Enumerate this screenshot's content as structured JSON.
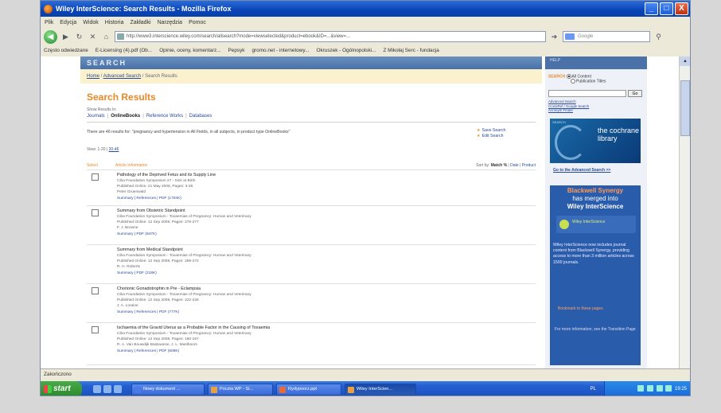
{
  "window": {
    "title": "Wiley InterScience: Search Results - Mozilla Firefox",
    "buttons": [
      "_",
      "□",
      "X"
    ]
  },
  "menu": [
    "Plik",
    "Edycja",
    "Widok",
    "Historia",
    "Zakładki",
    "Narzędzia",
    "Pomoc"
  ],
  "nav": {
    "url": "http://www3.interscience.wiley.com/search/allsearch?mode=viewselected&product=ebook&ID=...&view=...",
    "search_placeholder": "Google"
  },
  "bookmarks": [
    "Często odwiedzane",
    "E-Licensing (4).pdf (Ob...",
    "Opinie, oceny, komentarz...",
    "Pepsyk",
    "gromo.net - internetowy...",
    "Okruszek - Ogólnopolski...",
    "Z Mikołaj Serc - fundacja"
  ],
  "page": {
    "search_band": "SEARCH",
    "right_band": "HELP",
    "breadcrumb": [
      "Home",
      "Advanced Search",
      "Search Results"
    ],
    "heading": "Search Results",
    "show_in": "Show Results In:",
    "tabs": [
      "Journals",
      "OnlineBooks",
      "Reference Works",
      "Databases"
    ],
    "active_tab": "OnlineBooks",
    "result_info": "There are 46 results for: \"pregnancy and hypertension in All Fields, in all subjects, in product type OnlineBooks\"",
    "save_search": "Save Search",
    "edit_search": "Edit Search",
    "view_label": "View: 1-20",
    "next_label": "20-46",
    "col_select": "Select",
    "col_article": "Article Information",
    "sort_label": "Sort by:",
    "sort_match": "Match %",
    "sort_date": "Date",
    "sort_product": "Product"
  },
  "results": [
    {
      "title": "Pathology of the Deprived Fetus and its Supply Line",
      "l1": "Ciba Foundation Symposium 27 - Size at Birth",
      "l2": "Published Online: 21 May 2008, Pages: 3-28",
      "l3": "Peter Gruenwald",
      "links": "Summary | References | PDF (1704K)"
    },
    {
      "title": "Summary from Obstetric Standpoint",
      "l1": "Ciba Foundation Symposium - Toxaemias of Pregnancy: Human and Veterinary",
      "l2": "Published Online: 12 Sep 2008, Pages: 275-277",
      "l3": "F. J. Browne",
      "links": "Summary | PDF (847K)"
    },
    {
      "title": "Summary from Medical Standpoint",
      "l1": "Ciba Foundation Symposium - Toxaemias of Pregnancy: Human and Veterinary",
      "l2": "Published Online: 12 Sep 2008, Pages: 269-272",
      "l3": "R. H. Roberts",
      "links": "Summary | PDF (218K)"
    },
    {
      "title": "Chorionic Gonadotrophin in Pre - Eclampsia",
      "l1": "Ciba Foundation Symposium - Toxaemias of Pregnancy: Human and Veterinary",
      "l2": "Published Online: 12 Sep 2008, Pages: 222-226",
      "l3": "J. A. Loraine",
      "links": "Summary | References | PDF (777K)"
    },
    {
      "title": "Ischaemia of the Gravid Uterus as a Probable Factor in the Causing of Toxaemia",
      "l1": "Ciba Foundation Symposium - Toxaemias of Pregnancy: Human and Veterinary",
      "l2": "Published Online: 12 Sep 2008, Pages: 160-167",
      "l3": "R. A. Van Bouwdijk Bastiaanse, J. L. Mastboom",
      "links": "Summary | References | PDF (606K)"
    }
  ],
  "sidebar": {
    "search_label": "SEARCH",
    "radio1": "All Content",
    "radio2": "Publication Titles",
    "go": "Go",
    "links": [
      "Advanced Search",
      "CrossRef / Google Search",
      "Acronym Finder"
    ],
    "cochrane_top": "SEARCH",
    "cochrane_text": "the cochrane library",
    "adv_link": "Go to the Advanced Search >>",
    "bw_title": "Blackwell Synergy",
    "bw_sub": "has merged into",
    "bw_sub2": "Wiley InterScience",
    "bw_logo": "Wiley InterScience",
    "bw_para": "Wiley InterScience now includes journal content from Blackwell Synergy, providing access to more than 3 million articles across 1500 journals.",
    "bw_orange": "Bookmark to these pages",
    "bw_more": "For more information, see the Transition Page"
  },
  "status": "Zakończono",
  "taskbar": {
    "start": "start",
    "tasks": [
      "Nowy dokument ...",
      "Poczta WP - Si...",
      "Rydypoorz.ppt",
      "Wiley InterScien..."
    ],
    "lang": "PL",
    "clock": "19:25"
  }
}
